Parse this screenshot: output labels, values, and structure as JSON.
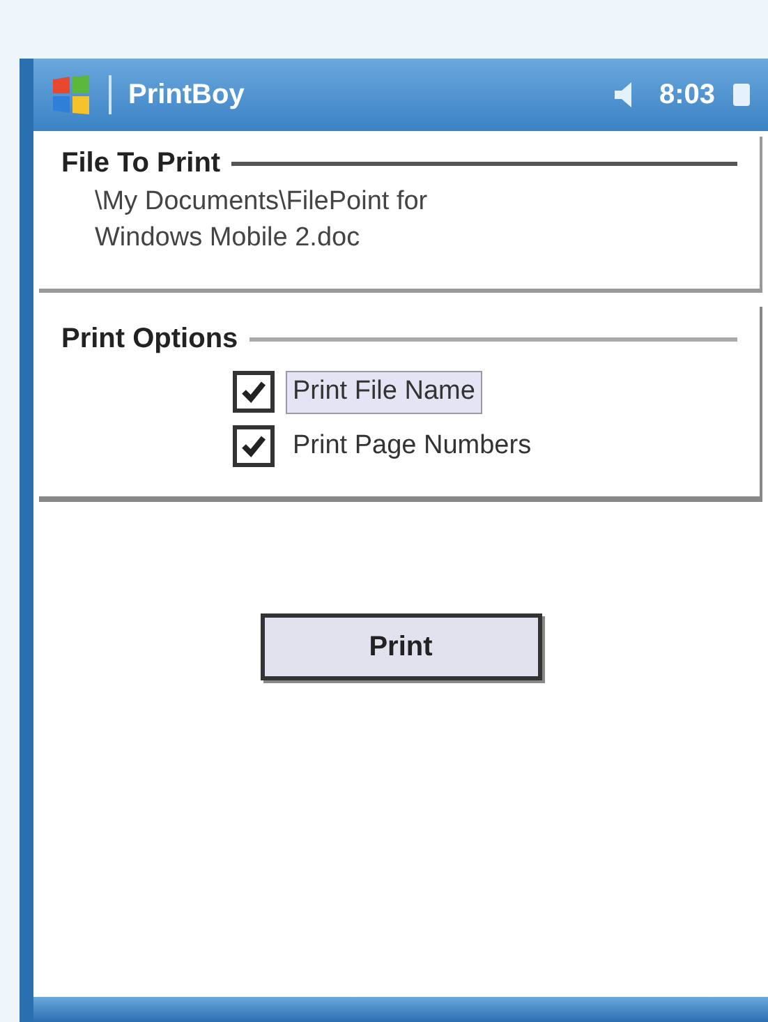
{
  "title_bar": {
    "title": "PrintBoy",
    "time": "8:03"
  },
  "file_group": {
    "label": "File To Print",
    "path": "\\My Documents\\FilePoint for Windows Mobile 2.doc"
  },
  "options_group": {
    "label": "Print Options",
    "options": [
      {
        "label": "Print File Name",
        "checked": true,
        "selected": true
      },
      {
        "label": "Print Page Numbers",
        "checked": true,
        "selected": false
      }
    ]
  },
  "print_button": "Print"
}
